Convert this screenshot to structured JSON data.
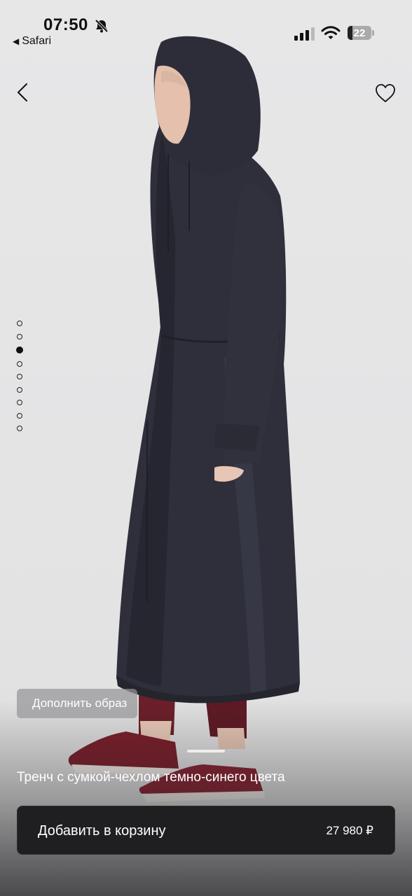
{
  "status_bar": {
    "time": "07:50",
    "back_app": "Safari",
    "battery_level": "22"
  },
  "nav": {
    "back_icon": "chevron-left-icon",
    "favorite_icon": "heart-icon"
  },
  "gallery": {
    "total_images": 9,
    "active_index": 2
  },
  "complete_look_label": "Дополнить образ",
  "product": {
    "title": "Тренч с сумкой-чехлом темно-синего цвета",
    "add_to_cart_label": "Добавить в корзину",
    "price": "27 980 ₽"
  },
  "colors": {
    "coat": "#2e2f3a",
    "background": "#e7e7e8",
    "leggings": "#6b1f2a",
    "sneakers": "#7a1e2a",
    "cart_button": "#1f1f21"
  }
}
